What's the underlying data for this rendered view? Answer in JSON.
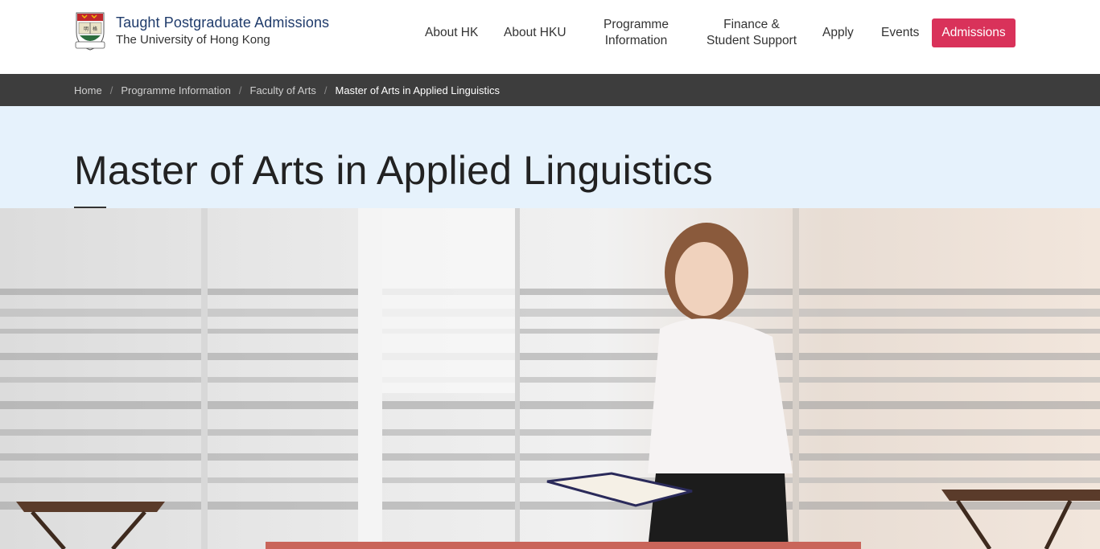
{
  "header": {
    "brand_title": "Taught Postgraduate Admissions",
    "brand_subtitle": "The University of Hong Kong",
    "nav": {
      "about_hk": "About HK",
      "about_hku": "About HKU",
      "programme_line1": "Programme",
      "programme_line2": "Information",
      "finance_line1": "Finance &",
      "finance_line2": "Student Support",
      "apply": "Apply",
      "events": "Events",
      "admissions": "Admissions"
    },
    "colors": {
      "accent": "#d9325a",
      "brand": "#1f3b6b"
    }
  },
  "breadcrumb": {
    "items": [
      "Home",
      "Programme Information",
      "Faculty of Arts"
    ],
    "current": "Master of Arts in Applied Linguistics",
    "separator": "/"
  },
  "page": {
    "title": "Master of Arts in Applied Linguistics"
  }
}
